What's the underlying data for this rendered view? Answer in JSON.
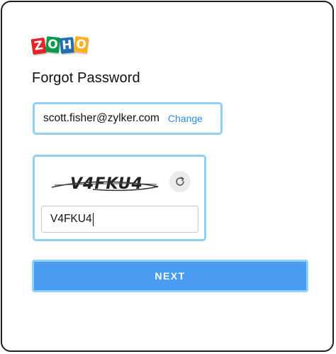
{
  "logo": {
    "letters": [
      "Z",
      "O",
      "H",
      "O"
    ],
    "colors": [
      "#e42527",
      "#089949",
      "#226db4",
      "#f9b21d"
    ]
  },
  "title": "Forgot Password",
  "email": {
    "value": "scott.fisher@zylker.com",
    "change_label": "Change"
  },
  "captcha": {
    "image_text": "V4FKU4",
    "input_value": "V4FKU4",
    "refresh_icon": "refresh-icon"
  },
  "next_label": "NEXT",
  "colors": {
    "accent_border": "#8fd0f3",
    "button": "#4a9cf2",
    "link": "#2b8be0"
  }
}
